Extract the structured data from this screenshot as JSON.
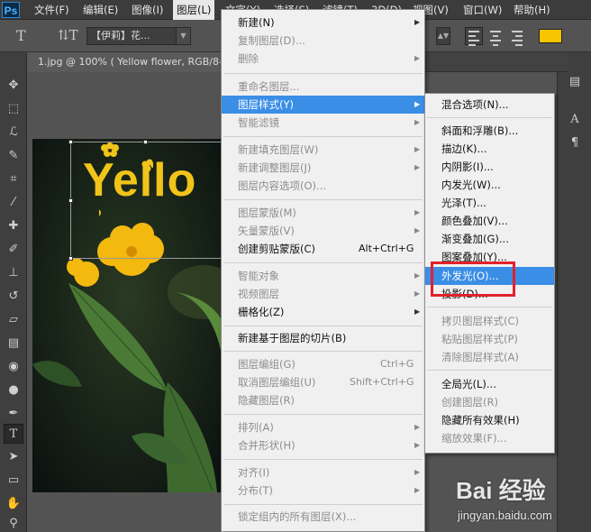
{
  "app": {
    "logo": "Ps"
  },
  "menubar": {
    "items": [
      {
        "label": "文件(F)"
      },
      {
        "label": "编辑(E)"
      },
      {
        "label": "图像(I)"
      },
      {
        "label": "图层(L)"
      },
      {
        "label": "文字(Y)"
      },
      {
        "label": "选择(S)"
      },
      {
        "label": "滤镜(T)"
      },
      {
        "label": "3D(D)"
      },
      {
        "label": "视图(V)"
      },
      {
        "label": "窗口(W)"
      },
      {
        "label": "帮助(H)"
      }
    ]
  },
  "options": {
    "font_family_value": "【伊莉】花...",
    "text_color": "#f6c400"
  },
  "document": {
    "tab_title": "1.jpg @ 100% ( Yellow flower, RGB/8#",
    "canvas_text": "Yello"
  },
  "layer_menu": {
    "items": [
      {
        "label": "新建(N)"
      },
      {
        "label": "复制图层(D)..."
      },
      {
        "label": "删除"
      },
      {
        "label": "重命名图层..."
      },
      {
        "label": "图层样式(Y)"
      },
      {
        "label": "智能滤镜"
      },
      {
        "label": "新建填充图层(W)"
      },
      {
        "label": "新建调整图层(J)"
      },
      {
        "label": "图层内容选项(O)..."
      },
      {
        "label": "图层蒙版(M)"
      },
      {
        "label": "矢量蒙版(V)"
      },
      {
        "label": "创建剪贴蒙版(C)",
        "shortcut": "Alt+Ctrl+G"
      },
      {
        "label": "智能对象"
      },
      {
        "label": "视频图层"
      },
      {
        "label": "栅格化(Z)"
      },
      {
        "label": "新建基于图层的切片(B)"
      },
      {
        "label": "图层编组(G)",
        "shortcut": "Ctrl+G"
      },
      {
        "label": "取消图层编组(U)",
        "shortcut": "Shift+Ctrl+G"
      },
      {
        "label": "隐藏图层(R)"
      },
      {
        "label": "排列(A)"
      },
      {
        "label": "合并形状(H)"
      },
      {
        "label": "对齐(I)"
      },
      {
        "label": "分布(T)"
      },
      {
        "label": "锁定组内的所有图层(X)..."
      }
    ]
  },
  "layer_style_submenu": {
    "items": [
      {
        "label": "混合选项(N)..."
      },
      {
        "label": "斜面和浮雕(B)..."
      },
      {
        "label": "描边(K)..."
      },
      {
        "label": "内阴影(I)..."
      },
      {
        "label": "内发光(W)..."
      },
      {
        "label": "光泽(T)..."
      },
      {
        "label": "颜色叠加(V)..."
      },
      {
        "label": "渐变叠加(G)..."
      },
      {
        "label": "图案叠加(Y)..."
      },
      {
        "label": "外发光(O)..."
      },
      {
        "label": "投影(D)..."
      },
      {
        "label": "拷贝图层样式(C)"
      },
      {
        "label": "粘贴图层样式(P)"
      },
      {
        "label": "清除图层样式(A)"
      },
      {
        "label": "全局光(L)..."
      },
      {
        "label": "创建图层(R)"
      },
      {
        "label": "隐藏所有效果(H)"
      },
      {
        "label": "缩放效果(F)..."
      }
    ]
  },
  "watermark": {
    "logo": "Bai 经验",
    "url": "jingyan.baidu.com"
  }
}
